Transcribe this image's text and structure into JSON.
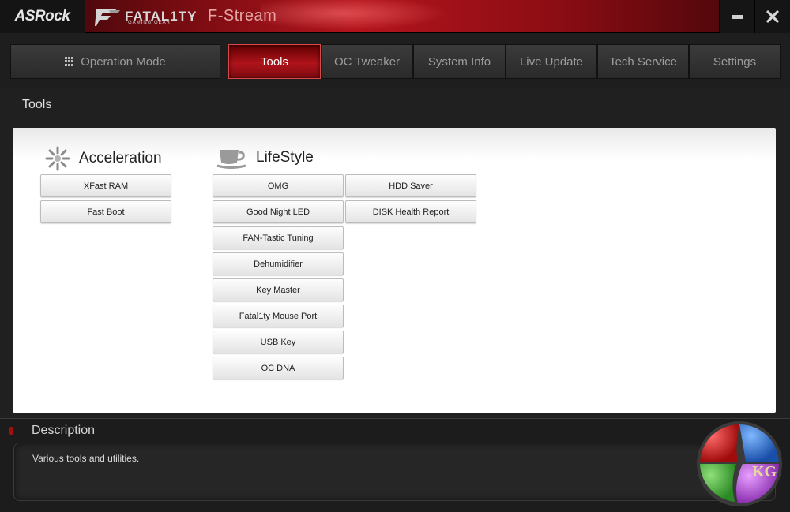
{
  "titlebar": {
    "brand": "ASRock",
    "sub_brand": "FATAL1TY",
    "sub_brand_tagline": "GAMING GEAR",
    "app_title": "F-Stream"
  },
  "nav": {
    "items": [
      {
        "label": "Operation Mode",
        "active": false,
        "icon": "grid-icon"
      },
      {
        "label": "Tools",
        "active": true
      },
      {
        "label": "OC Tweaker",
        "active": false
      },
      {
        "label": "System Info",
        "active": false
      },
      {
        "label": "Live Update",
        "active": false
      },
      {
        "label": "Tech Service",
        "active": false
      },
      {
        "label": "Settings",
        "active": false
      }
    ]
  },
  "section": {
    "title": "Tools"
  },
  "groups": {
    "acceleration": {
      "title": "Acceleration",
      "icon": "acceleration-burst-icon",
      "buttons": [
        "XFast RAM",
        "Fast Boot"
      ]
    },
    "lifestyle": {
      "title": "LifeStyle",
      "icon": "coffee-cup-icon",
      "buttons_col1": [
        "OMG",
        "Good Night LED",
        "FAN-Tastic Tuning",
        "Dehumidifier",
        "Key Master",
        "Fatal1ty Mouse Port",
        "USB Key",
        "OC DNA"
      ],
      "buttons_col2": [
        "HDD Saver",
        "DISK Health Report"
      ]
    }
  },
  "description": {
    "title": "Description",
    "text": "Various tools and utilities."
  },
  "watermark": {
    "text": "KG",
    "icon": "kitguru-watermark-icon"
  },
  "colors": {
    "accent": "#b0131b",
    "panel": "#ffffff",
    "background": "#202020"
  }
}
